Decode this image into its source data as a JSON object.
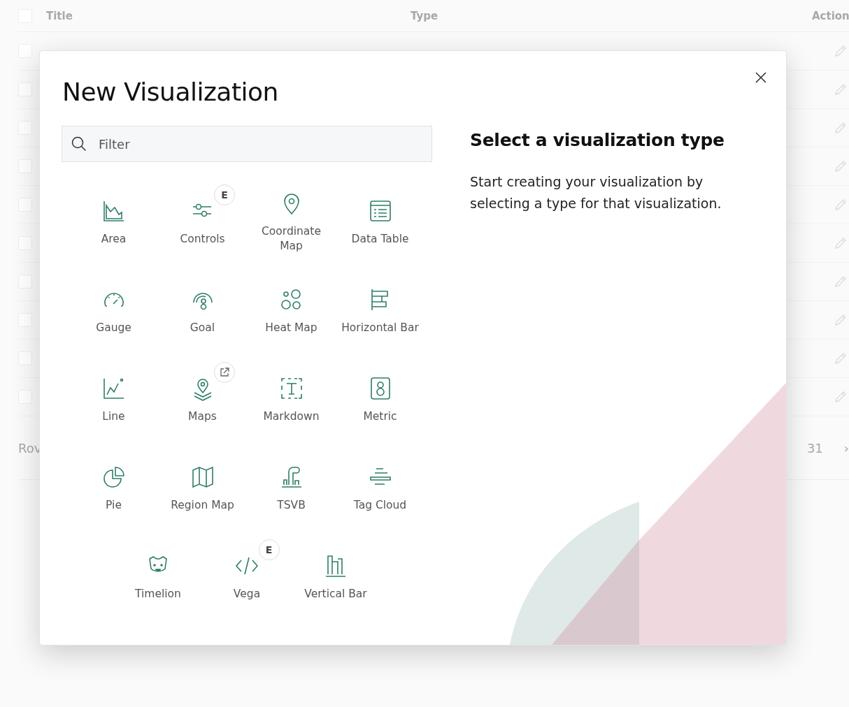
{
  "table": {
    "header_checked": false,
    "columns": [
      "Title",
      "Type",
      "Action"
    ],
    "rows": [
      {
        "checked": false
      },
      {
        "checked": false
      },
      {
        "checked": false
      },
      {
        "checked": false
      },
      {
        "checked": false
      },
      {
        "checked": false
      },
      {
        "checked": false
      },
      {
        "checked": false
      },
      {
        "checked": false
      },
      {
        "checked": false
      }
    ],
    "footer_left": "Rov",
    "page": "31",
    "next": "›"
  },
  "modal": {
    "title": "New Visualization",
    "filter": {
      "placeholder": "Filter"
    },
    "types": [
      {
        "label": "Area",
        "external_link": false
      },
      {
        "label": "Controls",
        "badge": "E",
        "external_link": false
      },
      {
        "label": "Coordinate Map",
        "external_link": false
      },
      {
        "label": "Data Table",
        "external_link": false
      },
      {
        "label": "Gauge",
        "external_link": false
      },
      {
        "label": "Goal",
        "external_link": false
      },
      {
        "label": "Heat Map",
        "external_link": false
      },
      {
        "label": "Horizontal Bar",
        "external_link": false
      },
      {
        "label": "Line",
        "external_link": false
      },
      {
        "label": "Maps",
        "external_link": true
      },
      {
        "label": "Markdown",
        "external_link": false
      },
      {
        "label": "Metric",
        "external_link": false
      },
      {
        "label": "Pie",
        "external_link": false
      },
      {
        "label": "Region Map",
        "external_link": false
      },
      {
        "label": "TSVB",
        "external_link": false
      },
      {
        "label": "Tag Cloud",
        "external_link": false
      },
      {
        "label": "Timelion",
        "external_link": false
      },
      {
        "label": "Vega",
        "badge": "E",
        "external_link": false
      },
      {
        "label": "Vertical Bar",
        "external_link": false
      }
    ],
    "heading": "Select a visualization type",
    "description": "Start creating your visualization by selecting a type for that visualization."
  }
}
